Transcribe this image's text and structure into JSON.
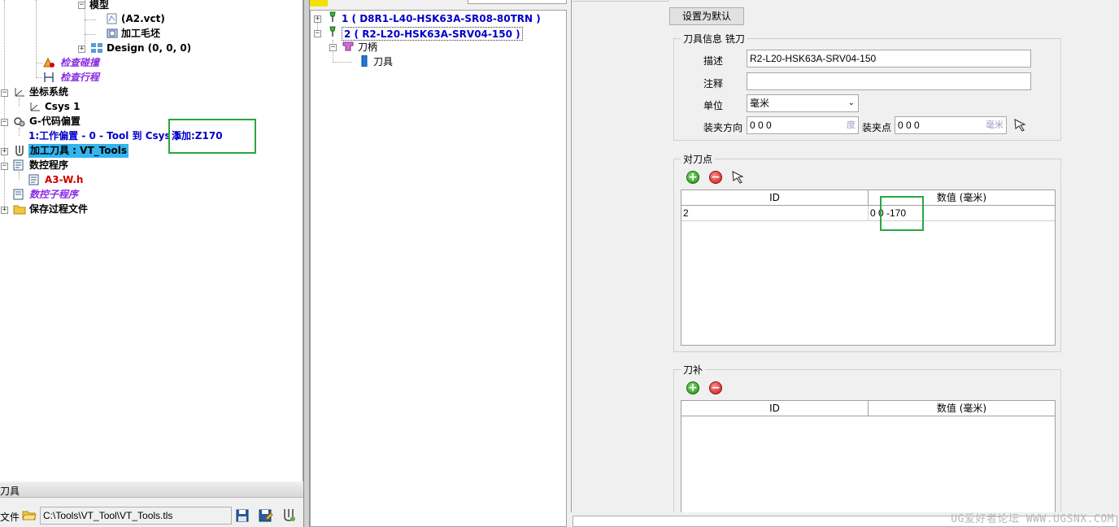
{
  "left_tree": {
    "nodes": {
      "model": "模型",
      "a2_vct": "(A2.vct)",
      "stock": "加工毛坯",
      "design": "Design (0, 0, 0)",
      "check_collision": "检查碰撞",
      "check_travel": "检查行程",
      "coord_system": "坐标系统",
      "csys1": "Csys 1",
      "gcode_offset": "G-代码偏置",
      "work_offset_1": "1:工作偏置 - 0 - Tool 到 Csys 1",
      "machine_tools": "加工刀具 : VT_Tools",
      "nc_program": "数控程序",
      "a3_wh": "A3-W.h",
      "nc_subprogram": "数控子程序",
      "save_process": "保存过程文件"
    },
    "annotation": "添加:Z170"
  },
  "tool_bar": {
    "section_label": "刀具",
    "file_label": "文件",
    "file_path": "C:\\Tools\\VT_Tool\\VT_Tools.tls"
  },
  "mid_tree": {
    "tool1": "1 ( D8R1-L40-HSK63A-SR08-80TRN )",
    "tool2": "2 ( R2-L20-HSK63A-SRV04-150 )",
    "holder": "刀柄",
    "cutter": "刀具"
  },
  "right_panel": {
    "set_default_button": "设置为默认",
    "tool_info_group": "刀具信息 铣刀",
    "fields": {
      "description_label": "描述",
      "description_value": "R2-L20-HSK63A-SRV04-150",
      "comment_label": "注释",
      "comment_value": "",
      "units_label": "单位",
      "units_value": "毫米",
      "clamp_dir_label": "装夹方向",
      "clamp_dir_value": "0 0 0",
      "clamp_dir_unit": "度",
      "clamp_pt_label": "装夹点",
      "clamp_pt_value": "0 0 0",
      "clamp_pt_unit": "毫米"
    },
    "gauge_group": "对刀点",
    "gauge_table": {
      "columns": [
        "ID",
        "数值 (毫米)"
      ],
      "rows": [
        {
          "id": "2",
          "value": "0 0 -170"
        }
      ]
    },
    "comp_group": "刀补",
    "comp_table": {
      "columns": [
        "ID",
        "数值 (毫米)"
      ],
      "rows": []
    }
  },
  "watermark": "UG爱好者论坛 WWW.UGSNX.COM"
}
